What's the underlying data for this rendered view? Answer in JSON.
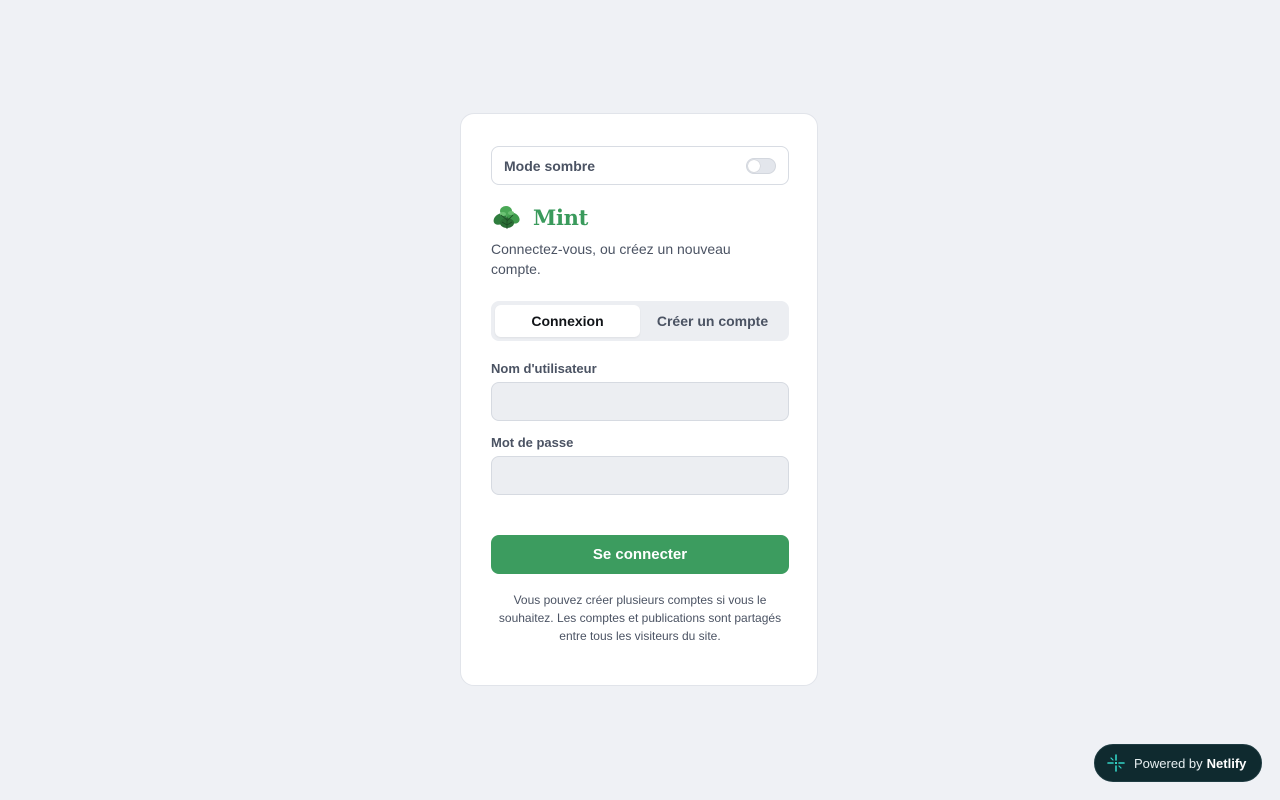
{
  "dark_mode": {
    "label": "Mode sombre",
    "enabled": false
  },
  "brand": {
    "name": "Mint",
    "logo_icon": "mint-leaf-icon",
    "color": "#3a9a5c"
  },
  "subtitle": "Connectez-vous, ou créez un nouveau compte.",
  "tabs": [
    {
      "label": "Connexion",
      "active": true
    },
    {
      "label": "Créer un compte",
      "active": false
    }
  ],
  "form": {
    "username_label": "Nom d'utilisateur",
    "username_value": "",
    "password_label": "Mot de passe",
    "password_value": "",
    "submit_label": "Se connecter",
    "submit_color": "#3c9c5f"
  },
  "note": "Vous pouvez créer plusieurs comptes si vous le souhaitez. Les comptes et publications sont partagés entre tous les visiteurs du site.",
  "netlify_badge": {
    "prefix": "Powered by",
    "brand": "Netlify",
    "icon": "netlify-icon"
  }
}
